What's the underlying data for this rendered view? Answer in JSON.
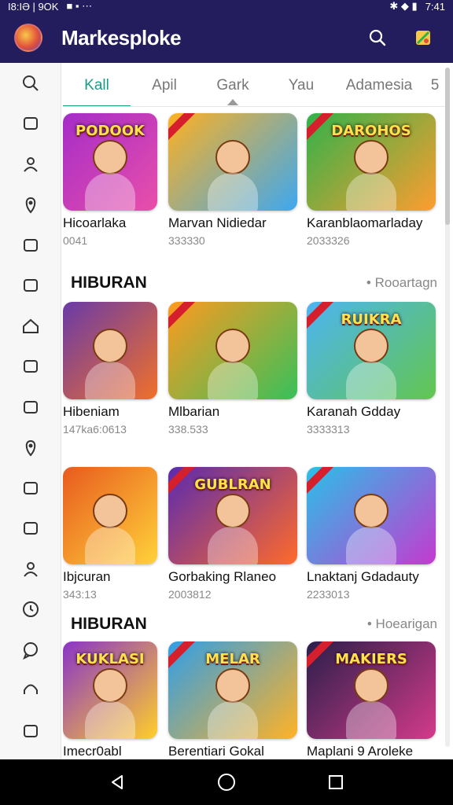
{
  "status": {
    "left": "I8:IƏ | 9OK",
    "right": "7:41"
  },
  "app": {
    "title": "Markesploke"
  },
  "tabs": [
    "Kall",
    "Apil",
    "Gark",
    "Yau",
    "Adamesia",
    "5"
  ],
  "rows": [
    {
      "cards": [
        {
          "title": "Hicoarlaka",
          "sub": "0041",
          "thumb_text": "PODOOK",
          "bg": [
            "#a52cc9",
            "#e94fa9"
          ]
        },
        {
          "title": "Marvan Nidiedar",
          "sub": "333330",
          "thumb_text": "",
          "bg": [
            "#ffb020",
            "#3da8f0"
          ]
        },
        {
          "title": "Karanblaomarladay",
          "sub": "2033326",
          "thumb_text": "DAROHOS",
          "bg": [
            "#2fb24a",
            "#ff9d2f"
          ]
        }
      ]
    },
    {
      "cards": [
        {
          "title": "Hibeniam",
          "sub": "147ka6:0613",
          "thumb_text": "",
          "bg": [
            "#6a3aa8",
            "#f0702a"
          ]
        },
        {
          "title": "Mlbarian",
          "sub": "338.533",
          "thumb_text": "",
          "bg": [
            "#ff9a1f",
            "#38c05a"
          ]
        },
        {
          "title": "Karanah Gdday",
          "sub": "3333313",
          "thumb_text": "RUIKRA",
          "bg": [
            "#4cb4f2",
            "#63c64f"
          ]
        }
      ]
    },
    {
      "cards": [
        {
          "title": "Ibjcuran",
          "sub": "343:13",
          "thumb_text": "",
          "bg": [
            "#e85a1e",
            "#ffd23a"
          ]
        },
        {
          "title": "Gorbaking Rlaneo",
          "sub": "2003812",
          "thumb_text": "GUBLRAN",
          "bg": [
            "#5a2ab0",
            "#ff6a2a"
          ]
        },
        {
          "title": "Lnaktanj Gdadauty",
          "sub": "2233013",
          "thumb_text": "",
          "bg": [
            "#2ac0e8",
            "#c43ad0"
          ]
        }
      ]
    },
    {
      "cards": [
        {
          "title": "Imecr0abl",
          "sub": "",
          "thumb_text": "KUKLASI",
          "bg": [
            "#8a34c8",
            "#ffcf2a"
          ]
        },
        {
          "title": "Berentiari Gokal",
          "sub": "",
          "thumb_text": "MELAR",
          "bg": [
            "#2f9ee8",
            "#ffb226"
          ]
        },
        {
          "title": "Maplani 9 Aroleke",
          "sub": "",
          "thumb_text": "MAKIERS",
          "bg": [
            "#2a1f4a",
            "#d43a8a"
          ]
        }
      ]
    }
  ],
  "sections": [
    {
      "title": "HIBURAN",
      "link": "• Rooartagn"
    },
    {
      "title": "HIBURAN",
      "link": "• Hoearigan"
    }
  ],
  "colors": {
    "appbar": "#231d5e",
    "accent": "#1a9a88"
  },
  "sidebar_icons": [
    "search-icon",
    "folder-icon",
    "user-icon",
    "location-icon",
    "gamepad-icon",
    "bookmark-icon",
    "home-icon",
    "gift-icon",
    "shopping-icon",
    "pin-icon",
    "group-icon",
    "library-icon",
    "person-icon",
    "clock-icon",
    "chat-icon",
    "headset-icon",
    "inbox-icon"
  ]
}
